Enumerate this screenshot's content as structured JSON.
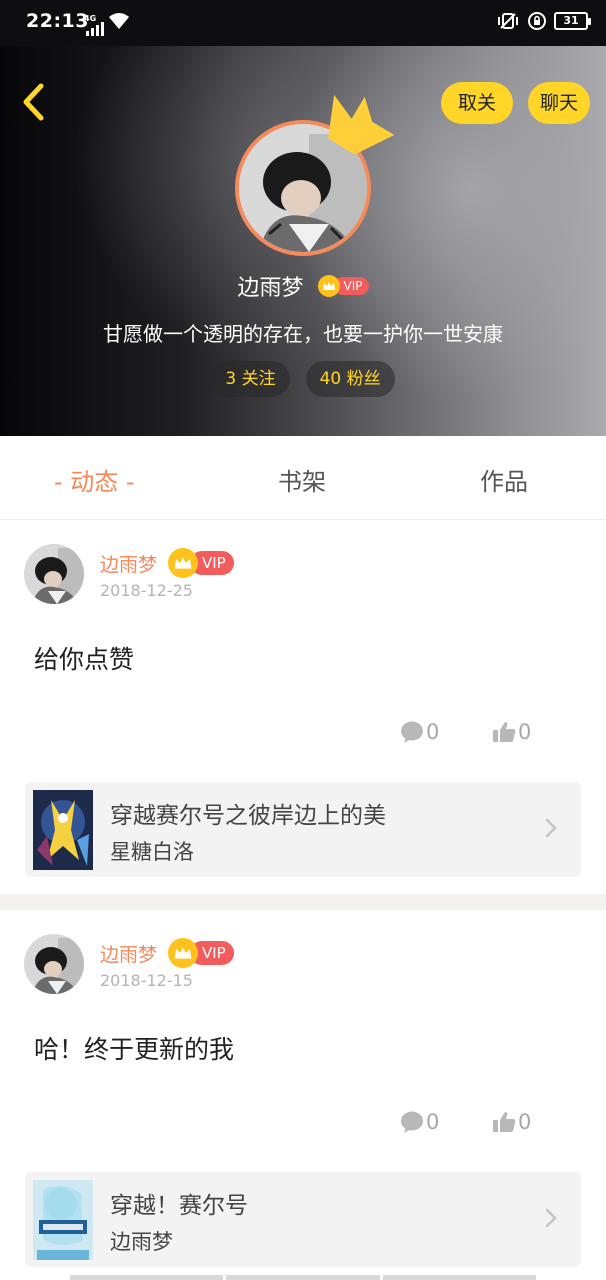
{
  "status_bar": {
    "time": "22:13",
    "network": "4G",
    "battery": "31"
  },
  "header": {
    "unfollow_label": "取关",
    "chat_label": "聊天",
    "username": "边雨梦",
    "vip_label": "VIP",
    "signature": "甘愿做一个透明的存在，也要一护你一世安康",
    "following": "3 关注",
    "fans": "40 粉丝"
  },
  "tabs": [
    {
      "label": "- 动态 -",
      "active": true
    },
    {
      "label": "书架",
      "active": false
    },
    {
      "label": "作品",
      "active": false
    }
  ],
  "posts": [
    {
      "author": "边雨梦",
      "vip_label": "VIP",
      "date": "2018-12-25",
      "text": "给你点赞",
      "comments": "0",
      "likes": "0",
      "book": {
        "title": "穿越赛尔号之彼岸边上的美",
        "author": "星糖白洛"
      }
    },
    {
      "author": "边雨梦",
      "vip_label": "VIP",
      "date": "2018-12-15",
      "text": "哈！终于更新的我",
      "comments": "0",
      "likes": "0",
      "book": {
        "title": "穿越！赛尔号",
        "author": "边雨梦"
      }
    }
  ],
  "colors": {
    "accent_orange": "#f5885a",
    "accent_yellow": "#ffd628",
    "vip_red": "#f25c5c",
    "vip_gold": "#ffc21a"
  }
}
